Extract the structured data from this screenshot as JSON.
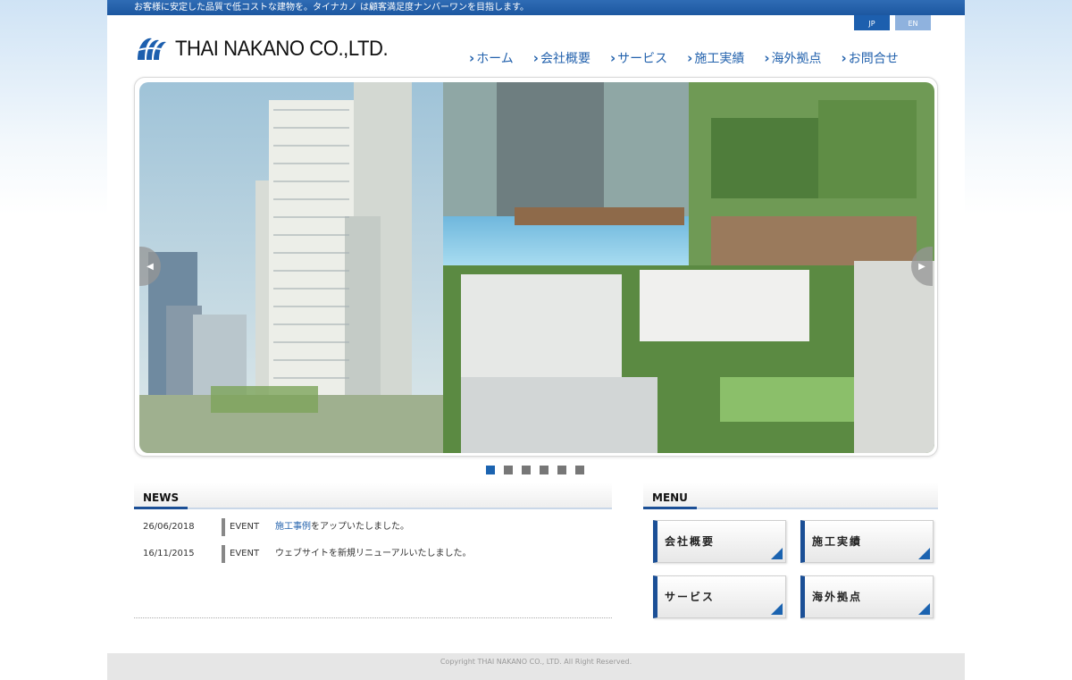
{
  "topbar": {
    "tagline": "お客様に安定した品質で低コストな建物を。タイナカノ は顧客満足度ナンバーワンを目指します。"
  },
  "lang": {
    "jp": "JP",
    "en": "EN"
  },
  "brand": {
    "company_name": "THAI NAKANO CO.,LTD.",
    "logo_icon": "wave-logo-icon",
    "color": "#1d5fae"
  },
  "nav": {
    "items": [
      {
        "label": "ホーム"
      },
      {
        "label": "会社概要"
      },
      {
        "label": "サービス"
      },
      {
        "label": "施工実績"
      },
      {
        "label": "海外拠点"
      },
      {
        "label": "お問合せ"
      }
    ]
  },
  "slider": {
    "prev_symbol": "◀",
    "next_symbol": "▶",
    "slide_count": 6,
    "active_index": 0
  },
  "news": {
    "title": "NEWS",
    "items": [
      {
        "date": "26/06/2018",
        "category": "EVENT",
        "link_text": "施工事例",
        "text": "をアップいたしました。"
      },
      {
        "date": "16/11/2015",
        "category": "EVENT",
        "link_text": "",
        "text": "ウェブサイトを新規リニューアルいたしました。"
      }
    ]
  },
  "menu": {
    "title": "MENU",
    "buttons": [
      {
        "label": "会社概要"
      },
      {
        "label": "施工実績"
      },
      {
        "label": "サービス"
      },
      {
        "label": "海外拠点"
      }
    ]
  },
  "footer": {
    "copyright": "Copyright THAI NAKANO CO., LTD. All Right Reserved."
  }
}
